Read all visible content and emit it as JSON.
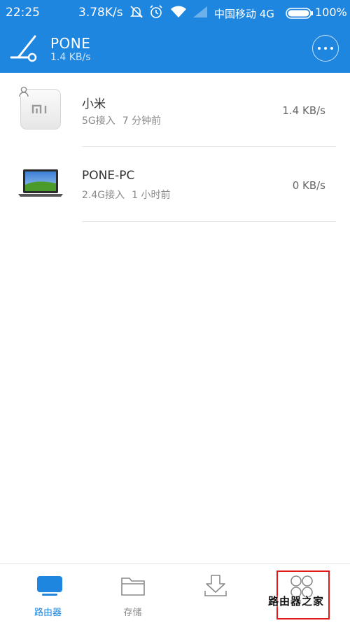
{
  "status_bar": {
    "time": "22:25",
    "net_speed": "3.78K/s",
    "carrier": "中国移动 4G",
    "battery": "100%",
    "icons": [
      "mute-icon",
      "alarm-icon",
      "wifi-icon",
      "signal-icon",
      "battery-icon"
    ]
  },
  "header": {
    "title": "PONE",
    "subtitle": "1.4 KB/s",
    "bg_color": "#1f86df"
  },
  "devices": [
    {
      "name": "小米",
      "connection": "5G接入",
      "last_seen": "7 分钟前",
      "speed": "1.4 KB/s",
      "icon": "mi-phone-icon",
      "has_user_badge": true
    },
    {
      "name": "PONE-PC",
      "connection": "2.4G接入",
      "last_seen": "1 小时前",
      "speed": "0 KB/s",
      "icon": "laptop-icon",
      "has_user_badge": false
    }
  ],
  "bottom_nav": {
    "items": [
      {
        "label": "路由器",
        "icon": "router-icon",
        "active": true
      },
      {
        "label": "存储",
        "icon": "folder-icon",
        "active": false
      },
      {
        "label": "",
        "icon": "download-icon",
        "active": false
      },
      {
        "label": "",
        "icon": "friends-icon",
        "active": false
      }
    ],
    "active_color": "#1f86df"
  },
  "overlay": {
    "highlight_color": "#e0191b",
    "watermark_text": "路由器之家"
  }
}
